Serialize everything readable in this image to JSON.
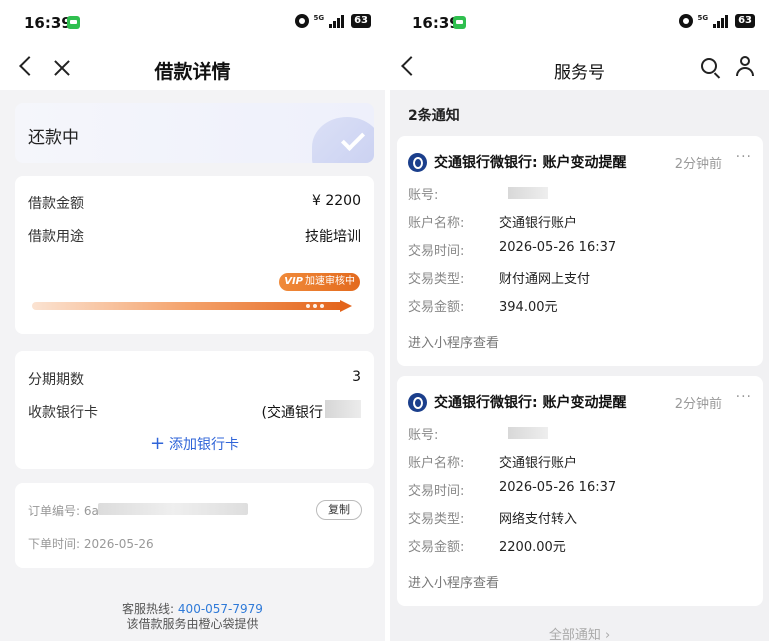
{
  "status_bar": {
    "time": "16:39",
    "battery": "63",
    "network": "5G"
  },
  "left": {
    "nav_title": "借款详情",
    "loan_status": "还款中",
    "amount_label": "借款金额",
    "amount_value": "¥ 2200",
    "purpose_label": "借款用途",
    "purpose_value": "技能培训",
    "vip_badge": "加速审核中",
    "vip_prefix": "VIP",
    "installments_label": "分期期数",
    "installments_value": "3",
    "bank_card_label": "收款银行卡",
    "bank_card_value": "(交通银行",
    "add_card_label": "添加银行卡",
    "order_label": "订单编号: 6a",
    "copy_label": "复制",
    "order_time_label": "下单时间: 2026-05-26",
    "hotline_label": "客服热线:",
    "hotline_number": "400-057-7979",
    "provider_note": "该借款服务由橙心袋提供"
  },
  "right": {
    "nav_title": "服务号",
    "count_text": "2条通知",
    "notifications": [
      {
        "title": "交通银行微银行: 账户变动提醒",
        "time": "2分钟前",
        "fields": [
          {
            "k": "账号:",
            "v": ""
          },
          {
            "k": "账户名称:",
            "v": "交通银行账户"
          },
          {
            "k": "交易时间:",
            "v": "2026-05-26 16:37"
          },
          {
            "k": "交易类型:",
            "v": "财付通网上支付"
          },
          {
            "k": "交易金额:",
            "v": "394.00元"
          }
        ],
        "enter": "进入小程序查看"
      },
      {
        "title": "交通银行微银行: 账户变动提醒",
        "time": "2分钟前",
        "fields": [
          {
            "k": "账号:",
            "v": ""
          },
          {
            "k": "账户名称:",
            "v": "交通银行账户"
          },
          {
            "k": "交易时间:",
            "v": "2026-05-26 16:37"
          },
          {
            "k": "交易类型:",
            "v": "网络支付转入"
          },
          {
            "k": "交易金额:",
            "v": "2200.00元"
          }
        ],
        "enter": "进入小程序查看"
      }
    ],
    "all_notifications": "全部通知 ›"
  },
  "colors": {
    "accent_blue": "#2f64d8",
    "vip_orange": "#e36a1e",
    "bank_blue": "#1b3f8c"
  }
}
